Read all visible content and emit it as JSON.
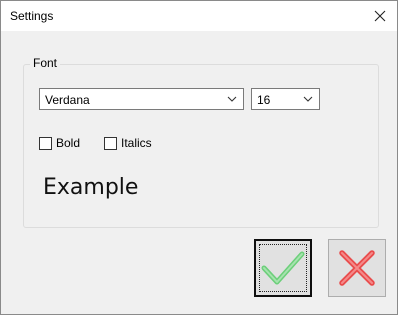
{
  "window": {
    "title": "Settings"
  },
  "font_group": {
    "label": "Font",
    "font_family": "Verdana",
    "font_size": "16",
    "bold": {
      "label": "Bold",
      "checked": false
    },
    "italics": {
      "label": "Italics",
      "checked": false
    },
    "preview_text": "Example"
  },
  "buttons": {
    "ok_icon": "checkmark-icon",
    "cancel_icon": "x-icon"
  },
  "colors": {
    "ok_green": "#6ccf7a",
    "cancel_red": "#e94b4b"
  }
}
